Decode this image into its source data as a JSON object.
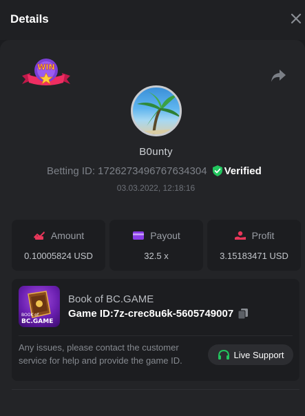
{
  "dialog": {
    "title": "Details"
  },
  "player": {
    "username": "B0unty",
    "betting_id_label": "Betting ID:",
    "betting_id": "1726273496767634304",
    "verified_label": "Verified",
    "timestamp": "03.03.2022, 12:18:16"
  },
  "stats": [
    {
      "label": "Amount",
      "value": "0.10005824 USD",
      "icon": "coins-icon",
      "color": "#e8375a"
    },
    {
      "label": "Payout",
      "value": "32.5 x",
      "icon": "card-icon",
      "color": "#8a3ee8"
    },
    {
      "label": "Profit",
      "value": "3.15183471 USD",
      "icon": "profit-hand-icon",
      "color": "#e8375a"
    }
  ],
  "game": {
    "name": "Book of BC.GAME",
    "id_label": "Game ID:",
    "id": "7z-crec8u6k-5605749007",
    "thumb_text": "BC.GAME",
    "thumb_subtext": "BOOK of"
  },
  "support": {
    "notice": "Any issues, please contact the customer service for help and provide the game ID.",
    "button_label": "Live Support"
  },
  "badge": {
    "text": "WIN"
  },
  "colors": {
    "accent_green": "#22c55e",
    "background": "#1b1c1f",
    "panel": "#232427",
    "card": "#1c1d20"
  }
}
